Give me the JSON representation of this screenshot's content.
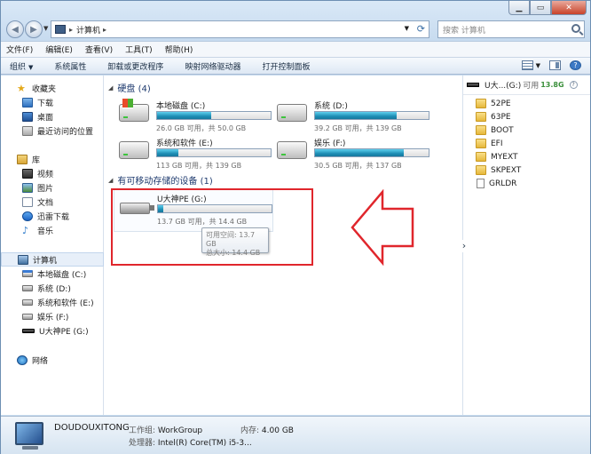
{
  "address": {
    "crumbs": [
      "计算机"
    ],
    "search_placeholder": "搜索 计算机"
  },
  "menubar": [
    "文件(F)",
    "编辑(E)",
    "查看(V)",
    "工具(T)",
    "帮助(H)"
  ],
  "commands": {
    "organize": "组织",
    "items": [
      "系统属性",
      "卸载或更改程序",
      "映射网络驱动器",
      "打开控制面板"
    ]
  },
  "nav": {
    "favorites": {
      "header": "收藏夹",
      "items": [
        "下载",
        "桌面",
        "最近访问的位置"
      ]
    },
    "libraries": {
      "header": "库",
      "items": [
        "视频",
        "图片",
        "文档",
        "迅雷下载",
        "音乐"
      ]
    },
    "computer": {
      "header": "计算机",
      "items": [
        "本地磁盘 (C:)",
        "系统 (D:)",
        "系统和软件 (E:)",
        "娱乐 (F:)",
        "U大神PE (G:)"
      ]
    },
    "network": {
      "header": "网络"
    }
  },
  "groups": {
    "hard_disks": "硬盘 (4)",
    "removable": "有可移动存储的设备 (1)"
  },
  "drives": [
    {
      "name": "本地磁盘 (C:)",
      "space": "26.0 GB 可用，共 50.0 GB",
      "used_fraction": 0.48
    },
    {
      "name": "系统 (D:)",
      "space": "39.2 GB 可用，共 139 GB",
      "used_fraction": 0.72
    },
    {
      "name": "系统和软件 (E:)",
      "space": "113 GB 可用，共 139 GB",
      "used_fraction": 0.19
    },
    {
      "name": "娱乐 (F:)",
      "space": "30.5 GB 可用，共 137 GB",
      "used_fraction": 0.78
    }
  ],
  "removable": {
    "name": "U大神PE (G:)",
    "space": "13.7 GB 可用，共 14.4 GB",
    "used_fraction": 0.05
  },
  "tooltip": {
    "line1": "可用空间: 13.7 GB",
    "line2": "总大小: 14.4 GB"
  },
  "preview": {
    "title": "U大...(G:)",
    "avail_label": "可用",
    "free": "13.8G",
    "items": [
      {
        "name": "52PE",
        "type": "folder"
      },
      {
        "name": "63PE",
        "type": "folder"
      },
      {
        "name": "BOOT",
        "type": "folder"
      },
      {
        "name": "EFI",
        "type": "folder"
      },
      {
        "name": "MYEXT",
        "type": "folder"
      },
      {
        "name": "SKPEXT",
        "type": "folder"
      },
      {
        "name": "GRLDR",
        "type": "file"
      }
    ]
  },
  "details": {
    "pc_name": "DOUDOUXITONG",
    "workgroup_label": "工作组:",
    "workgroup": "WorkGroup",
    "memory_label": "内存:",
    "memory": "4.00 GB",
    "cpu_label": "处理器:",
    "cpu": "Intel(R) Core(TM) i5-3..."
  },
  "colors": {
    "highlight": "#e0262c",
    "bar_fill": "#1e8eb5"
  }
}
